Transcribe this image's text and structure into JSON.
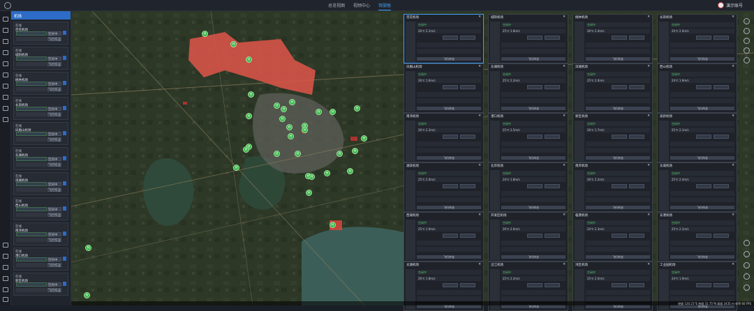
{
  "header": {
    "nav": [
      {
        "label": "总览视图",
        "active": false
      },
      {
        "label": "视频中心",
        "active": false
      },
      {
        "label": "驾驶舱",
        "active": true
      }
    ],
    "user": "演示账号"
  },
  "sidebar": {
    "title": "机场",
    "docks": [
      {
        "tag": "在线",
        "name": "百花机场",
        "status": "空闲中",
        "btn": "飞行作业"
      },
      {
        "tag": "在线",
        "name": "城阳机场",
        "status": "空闲中",
        "btn": "飞行作业"
      },
      {
        "tag": "在线",
        "name": "桃林机场",
        "status": "空闲中",
        "btn": "飞行作业"
      },
      {
        "tag": "在线",
        "name": "长岗机场",
        "status": "空闲中",
        "btn": "飞行作业"
      },
      {
        "tag": "在线",
        "name": "凤凰山机场",
        "status": "空闲中",
        "btn": "飞行作业"
      },
      {
        "tag": "在线",
        "name": "东湖机场",
        "status": "空闲中",
        "btn": "飞行作业"
      },
      {
        "tag": "在线",
        "name": "滨湖机场",
        "status": "空闲中",
        "btn": "飞行作业"
      },
      {
        "tag": "在线",
        "name": "西山机场",
        "status": "空闲中",
        "btn": "飞行作业"
      },
      {
        "tag": "在线",
        "name": "南湾机场",
        "status": "空闲中",
        "btn": "飞行作业"
      },
      {
        "tag": "在线",
        "name": "港口机场",
        "status": "空闲中",
        "btn": "飞行作业"
      },
      {
        "tag": "在线",
        "name": "新区机场",
        "status": "空闲中",
        "btn": "飞行作业"
      }
    ]
  },
  "panels": [
    {
      "name": "百花机场",
      "status": "空闲中",
      "temp": "26℃",
      "wind": "2.1m/s",
      "action": "飞行作业"
    },
    {
      "name": "城阳机场",
      "status": "空闲中",
      "temp": "25℃",
      "wind": "1.8m/s",
      "action": "飞行作业"
    },
    {
      "name": "桃林机场",
      "status": "空闲中",
      "temp": "26℃",
      "wind": "2.4m/s",
      "action": "飞行作业"
    },
    {
      "name": "长岗机场",
      "status": "空闲中",
      "temp": "24℃",
      "wind": "2.0m/s",
      "action": "飞行作业"
    },
    {
      "name": "凤凰山机场",
      "status": "空闲中",
      "temp": "26℃",
      "wind": "1.6m/s",
      "action": "飞行作业"
    },
    {
      "name": "东湖机场",
      "status": "空闲中",
      "temp": "25℃",
      "wind": "2.2m/s",
      "action": "飞行作业"
    },
    {
      "name": "滨湖机场",
      "status": "空闲中",
      "temp": "25℃",
      "wind": "2.0m/s",
      "action": "飞行作业"
    },
    {
      "name": "西山机场",
      "status": "空闲中",
      "temp": "24℃",
      "wind": "1.9m/s",
      "action": "飞行作业"
    },
    {
      "name": "南湾机场",
      "status": "空闲中",
      "temp": "26℃",
      "wind": "2.3m/s",
      "action": "飞行作业"
    },
    {
      "name": "港口机场",
      "status": "空闲中",
      "temp": "25℃",
      "wind": "2.5m/s",
      "action": "飞行作业"
    },
    {
      "name": "新区机场",
      "status": "空闲中",
      "temp": "26℃",
      "wind": "1.7m/s",
      "action": "飞行作业"
    },
    {
      "name": "高新机场",
      "status": "空闲中",
      "temp": "25℃",
      "wind": "2.1m/s",
      "action": "飞行作业"
    },
    {
      "name": "湖滨机场",
      "status": "空闲中",
      "temp": "25℃",
      "wind": "2.0m/s",
      "action": "飞行作业"
    },
    {
      "name": "北岸机场",
      "status": "空闲中",
      "temp": "24℃",
      "wind": "1.8m/s",
      "action": "飞行作业"
    },
    {
      "name": "南岸机场",
      "status": "空闲中",
      "temp": "26℃",
      "wind": "2.2m/s",
      "action": "飞行作业"
    },
    {
      "name": "东城机场",
      "status": "空闲中",
      "temp": "25℃",
      "wind": "2.4m/s",
      "action": "飞行作业"
    },
    {
      "name": "西城机场",
      "status": "空闲中",
      "temp": "25℃",
      "wind": "1.9m/s",
      "action": "飞行作业"
    },
    {
      "name": "开发区机场",
      "status": "空闲中",
      "temp": "26℃",
      "wind": "2.0m/s",
      "action": "飞行作业"
    },
    {
      "name": "临港机场",
      "status": "空闲中",
      "temp": "24℃",
      "wind": "2.3m/s",
      "action": "飞行作业"
    },
    {
      "name": "东港机场",
      "status": "空闲中",
      "temp": "25℃",
      "wind": "2.1m/s",
      "action": "飞行作业"
    },
    {
      "name": "太湖机场",
      "status": "空闲中",
      "temp": "26℃",
      "wind": "1.8m/s",
      "action": "飞行作业"
    },
    {
      "name": "沿江机场",
      "status": "空闲中",
      "temp": "25℃",
      "wind": "2.2m/s",
      "action": "飞行作业"
    },
    {
      "name": "湾区机场",
      "status": "空闲中",
      "temp": "25℃",
      "wind": "2.0m/s",
      "action": "飞行作业"
    },
    {
      "name": "工业园机场",
      "status": "空闲中",
      "temp": "24℃",
      "wind": "1.9m/s",
      "action": "飞行作业"
    }
  ],
  "statusbar": "经度 120.21°E  纬度 31.75°N  高度 2435 m  帧率 60 FPS"
}
